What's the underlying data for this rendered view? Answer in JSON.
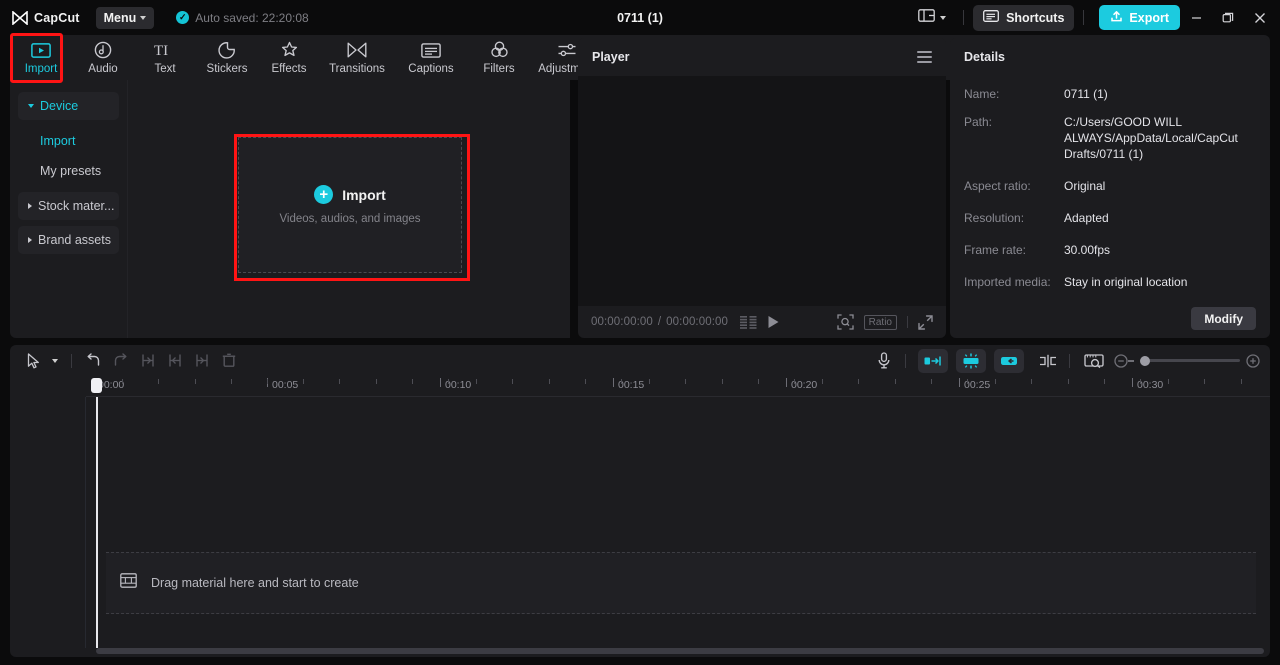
{
  "titlebar": {
    "brand": "CapCut",
    "menu_label": "Menu",
    "autosave_text": "Auto saved: 22:20:08",
    "autosave_icon": "check-circle-icon",
    "project_title": "0711 (1)",
    "layout_icon": "layout-icon",
    "shortcuts_label": "Shortcuts",
    "shortcuts_icon": "keyboard-icon",
    "export_label": "Export",
    "export_icon": "upload-icon",
    "minimize_label": "–",
    "maximize_label": "❐",
    "close_label": "✕",
    "accent_color": "#1ccbdf",
    "highlight_color": "#ff1414"
  },
  "tabs": [
    {
      "label": "Import",
      "icon": "import-media-icon",
      "active": true
    },
    {
      "label": "Audio",
      "icon": "audio-note-icon",
      "active": false
    },
    {
      "label": "Text",
      "icon": "text-ti-icon",
      "active": false
    },
    {
      "label": "Stickers",
      "icon": "sticker-icon",
      "active": false
    },
    {
      "label": "Effects",
      "icon": "effects-star-icon",
      "active": false
    },
    {
      "label": "Transitions",
      "icon": "transitions-icon",
      "active": false
    },
    {
      "label": "Captions",
      "icon": "captions-icon",
      "active": false
    },
    {
      "label": "Filters",
      "icon": "filters-circles-icon",
      "active": false
    },
    {
      "label": "Adjustment",
      "icon": "adjustment-sliders-icon",
      "active": false
    }
  ],
  "sidebar": {
    "groups": [
      {
        "label": "Device",
        "expanded": true,
        "icon": "triangle-down-icon"
      },
      {
        "label": "Stock mater...",
        "expanded": false,
        "icon": "triangle-right-icon"
      },
      {
        "label": "Brand assets",
        "expanded": false,
        "icon": "triangle-right-icon"
      }
    ],
    "device_items": [
      {
        "label": "Import",
        "active": true
      },
      {
        "label": "My presets",
        "active": false
      }
    ]
  },
  "dropzone": {
    "title": "Import",
    "subtitle": "Videos, audios, and images",
    "plus_icon": "plus-circle-icon"
  },
  "player": {
    "title": "Player",
    "menu_icon": "hamburger-icon",
    "current_time": "00:00:00:00",
    "total_time": "00:00:00:00",
    "time_separator": "/",
    "frames_icon": "frames-icon",
    "play_icon": "play-icon",
    "zoom_fit_icon": "zoom-fit-icon",
    "ratio_label": "Ratio",
    "fullscreen_icon": "fullscreen-icon"
  },
  "details": {
    "title": "Details",
    "rows": [
      {
        "label": "Name:",
        "value": "0711 (1)"
      },
      {
        "label": "Path:",
        "value": "C:/Users/GOOD WILL ALWAYS/AppData/Local/CapCut Drafts/0711 (1)"
      },
      {
        "label": "Aspect ratio:",
        "value": "Original"
      },
      {
        "label": "Resolution:",
        "value": "Adapted"
      },
      {
        "label": "Frame rate:",
        "value": "30.00fps"
      },
      {
        "label": "Imported media:",
        "value": "Stay in original location"
      }
    ],
    "modify_label": "Modify"
  },
  "timeline": {
    "tools_left": [
      {
        "name": "select-tool",
        "icon": "cursor-arrow-icon",
        "dim": false
      },
      {
        "name": "tool-dropdown",
        "icon": "chevron-down-icon",
        "dim": false
      },
      {
        "name": "undo",
        "icon": "undo-icon",
        "dim": false
      },
      {
        "name": "redo",
        "icon": "redo-icon",
        "dim": true
      },
      {
        "name": "split-left",
        "icon": "trim-left-icon",
        "dim": true
      },
      {
        "name": "split-right",
        "icon": "trim-right-icon",
        "dim": true
      },
      {
        "name": "split-both",
        "icon": "trim-both-icon",
        "dim": true
      },
      {
        "name": "delete",
        "icon": "delete-icon",
        "dim": true
      }
    ],
    "tools_right": [
      {
        "name": "record-voiceover",
        "icon": "microphone-icon",
        "chip": false
      },
      {
        "name": "auto-cutout",
        "icon": "keyframe-left-icon",
        "chip": true
      },
      {
        "name": "snap-toggle",
        "icon": "magnet-snap-icon",
        "chip": true
      },
      {
        "name": "link-toggle",
        "icon": "link-icon",
        "chip": true
      },
      {
        "name": "split-clip",
        "icon": "split-icon",
        "chip": false
      },
      {
        "name": "preview-zoom",
        "icon": "preview-zoom-icon",
        "chip": false
      }
    ],
    "zoom_out_icon": "zoom-out-icon",
    "zoom_in_icon": "zoom-in-icon",
    "ruler_labels": [
      "00:00",
      "00:05",
      "00:10",
      "00:15",
      "00:20",
      "00:25",
      "00:30"
    ],
    "ruler_label_positions": [
      0,
      181,
      354,
      527,
      700,
      873,
      1046
    ],
    "drop_hint": "Drag material here and start to create",
    "drop_hint_icon": "film-strip-icon",
    "playhead_position": "00:00"
  }
}
